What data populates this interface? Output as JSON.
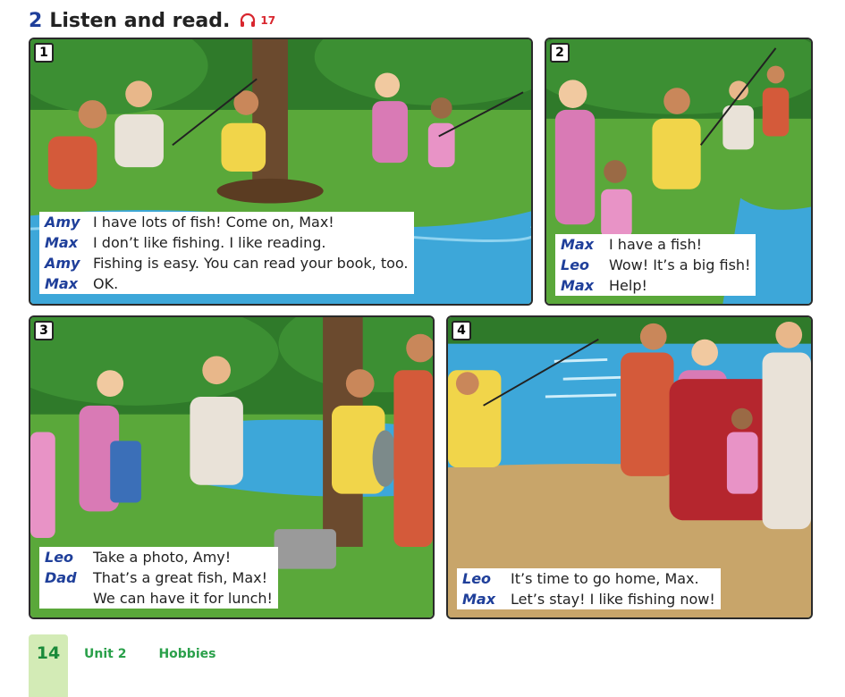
{
  "heading": {
    "number": "2",
    "title": "Listen and read.",
    "track": "17"
  },
  "panels": [
    {
      "number": "1",
      "lines": [
        {
          "speaker": "Amy",
          "text": "I have lots of fish! Come on, Max!"
        },
        {
          "speaker": "Max",
          "text": "I don’t like fishing. I like reading."
        },
        {
          "speaker": "Amy",
          "text": "Fishing is easy. You can read your book, too."
        },
        {
          "speaker": "Max",
          "text": "OK."
        }
      ]
    },
    {
      "number": "2",
      "lines": [
        {
          "speaker": "Max",
          "text": "I have a fish!"
        },
        {
          "speaker": "Leo",
          "text": "Wow! It’s a big fish!"
        },
        {
          "speaker": "Max",
          "text": "Help!"
        }
      ]
    },
    {
      "number": "3",
      "lines": [
        {
          "speaker": "Leo",
          "text": "Take a photo, Amy!"
        },
        {
          "speaker": "Dad",
          "text": "That’s a great fish, Max!"
        },
        {
          "speaker": "",
          "text": "We can have it for lunch!"
        }
      ]
    },
    {
      "number": "4",
      "lines": [
        {
          "speaker": "Leo",
          "text": "It’s time to go home, Max."
        },
        {
          "speaker": "Max",
          "text": "Let’s stay! I like fishing now!"
        }
      ]
    }
  ],
  "footer": {
    "page": "14",
    "unit": "Unit 2",
    "topic": "Hobbies"
  },
  "colors": {
    "speaker": "#1f3f9a",
    "footer_green": "#2aa04a",
    "page_tab": "#d3ebb6",
    "audio": "#d8262e"
  },
  "icons": {
    "audio": "headphones-icon"
  }
}
